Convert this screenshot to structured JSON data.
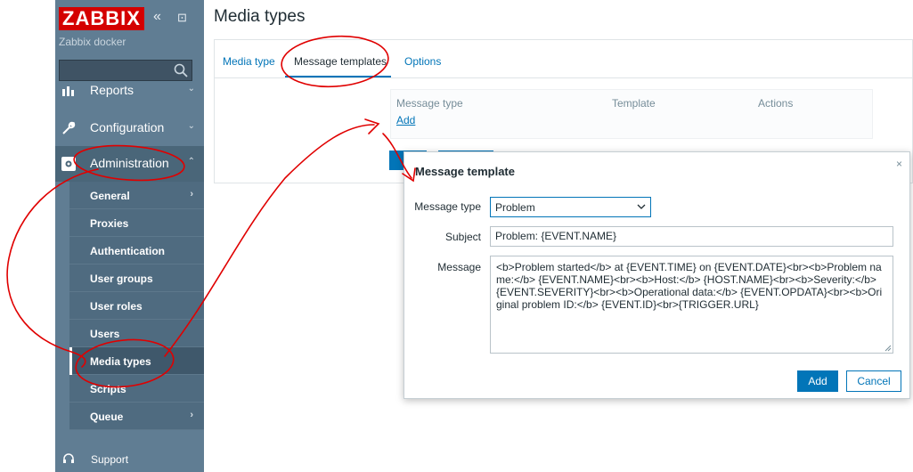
{
  "sidebar": {
    "logo": "ZABBIX",
    "collapse_glyph": "«",
    "kiosk_glyph": "⊡",
    "server_name": "Zabbix docker",
    "search": {
      "value": "",
      "placeholder": ""
    },
    "menu": [
      {
        "label": "Reports",
        "chevron": "⌄"
      },
      {
        "label": "Configuration",
        "chevron": "⌄"
      },
      {
        "label": "Administration",
        "chevron": "⌃"
      }
    ],
    "admin_items": [
      {
        "label": "General",
        "chevron": "›"
      },
      {
        "label": "Proxies"
      },
      {
        "label": "Authentication"
      },
      {
        "label": "User groups"
      },
      {
        "label": "User roles"
      },
      {
        "label": "Users"
      },
      {
        "label": "Media types"
      },
      {
        "label": "Scripts"
      },
      {
        "label": "Queue",
        "chevron": "›"
      }
    ],
    "support": "Support"
  },
  "page": {
    "title": "Media types",
    "tabs": [
      "Media type",
      "Message templates",
      "Options"
    ],
    "table": {
      "columns": [
        "Message type",
        "Template",
        "Actions"
      ],
      "add_link": "Add"
    }
  },
  "modal": {
    "title": "Message template",
    "close": "×",
    "message_type_label": "Message type",
    "message_type_value": "Problem",
    "subject_label": "Subject",
    "subject_value": "Problem: {EVENT.NAME}",
    "message_label": "Message",
    "message_value": "<b>Problem started</b> at {EVENT.TIME} on {EVENT.DATE}<br><b>Problem name:</b> {EVENT.NAME}<br><b>Host:</b> {HOST.NAME}<br><b>Severity:</b> {EVENT.SEVERITY}<br><b>Operational data:</b> {EVENT.OPDATA}<br><b>Original problem ID:</b> {EVENT.ID}<br>{TRIGGER.URL}",
    "add_button": "Add",
    "cancel_button": "Cancel"
  },
  "colors": {
    "sidebar": "#607d93",
    "accent": "#0275b8",
    "logo": "#d40000",
    "annotation": "#e00000"
  }
}
